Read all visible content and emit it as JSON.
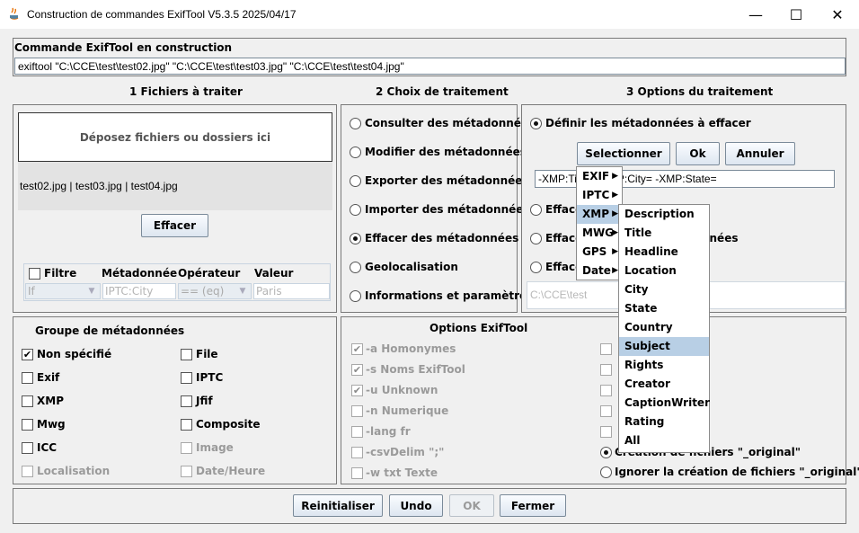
{
  "window": {
    "title": "Construction de commandes ExifTool V5.3.5 2025/04/17",
    "minimize_icon": "—",
    "maximize_icon": "☐",
    "close_icon": "✕"
  },
  "command": {
    "label": "Commande ExifTool en construction",
    "value": "exiftool  \"C:\\CCE\\test\\test02.jpg\" \"C:\\CCE\\test\\test03.jpg\" \"C:\\CCE\\test\\test04.jpg\""
  },
  "sections": {
    "files": "1  Fichiers à traiter",
    "choice": "2  Choix de traitement",
    "options": "3 Options du traitement"
  },
  "files": {
    "drop_label": "Déposez fichiers ou dossiers ici",
    "file_list": "test02.jpg | test03.jpg | test04.jpg",
    "clear_button": "Effacer",
    "filter": {
      "checkbox_label": "Filtre",
      "col_metadata": "Métadonnée",
      "col_operator": "Opérateur",
      "col_value": "Valeur",
      "if_value": "If",
      "metadata_placeholder": "IPTC:City",
      "operator_value": "== (eq)",
      "value_placeholder": "Paris"
    }
  },
  "treatments": [
    {
      "label": "Consulter des métadonnées",
      "selected": false
    },
    {
      "label": "Modifier des métadonnées",
      "selected": false
    },
    {
      "label": "Exporter des métadonnées",
      "selected": false
    },
    {
      "label": "Importer des métadonnées",
      "selected": false
    },
    {
      "label": "Effacer des métadonnées",
      "selected": true
    },
    {
      "label": "Geolocalisation",
      "selected": false
    },
    {
      "label": "Informations et paramètres",
      "selected": false
    }
  ],
  "options_panel": {
    "define_radio": "Définir les métadonnées à effacer",
    "select_button": "Selectionner",
    "ok_button": "Ok",
    "cancel_button": "Annuler",
    "tags_value": "-XMP:Title= -XMP:City= -XMP:State=",
    "radio2": "Effacer",
    "radio3": "Effacer toutes les métadonnées",
    "radio4": "Effacer",
    "path_value": "C:\\CCE\\test"
  },
  "groups": {
    "title": "Groupe de métadonnées",
    "left": [
      {
        "label": "Non spécifié",
        "checked": true,
        "disabled": false
      },
      {
        "label": "Exif",
        "checked": false,
        "disabled": false
      },
      {
        "label": "XMP",
        "checked": false,
        "disabled": false
      },
      {
        "label": "Mwg",
        "checked": false,
        "disabled": false
      },
      {
        "label": "ICC",
        "checked": false,
        "disabled": false
      },
      {
        "label": "Localisation",
        "checked": false,
        "disabled": true
      }
    ],
    "right": [
      {
        "label": "File",
        "checked": false,
        "disabled": false
      },
      {
        "label": "IPTC",
        "checked": false,
        "disabled": false
      },
      {
        "label": "Jfif",
        "checked": false,
        "disabled": false
      },
      {
        "label": "Composite",
        "checked": false,
        "disabled": false
      },
      {
        "label": "Image",
        "checked": false,
        "disabled": true
      },
      {
        "label": "Date/Heure",
        "checked": false,
        "disabled": true
      }
    ]
  },
  "exiftool_options": {
    "title": "Options ExifTool",
    "left": [
      {
        "label": "-a Homonymes",
        "checked": true
      },
      {
        "label": "-s Noms ExifTool",
        "checked": true
      },
      {
        "label": "-u Unknown",
        "checked": true
      },
      {
        "label": "-n Numerique",
        "checked": false
      },
      {
        "label": "-lang fr",
        "checked": false
      },
      {
        "label": "-csvDelim \";\"",
        "checked": false
      },
      {
        "label": "-w txt Texte",
        "checked": false
      }
    ],
    "radio_create": "Création de fichiers \"_original\"",
    "radio_ignore": "Ignorer la création de fichiers \"_original\""
  },
  "bottom_buttons": [
    "Reinitialiser",
    "Undo",
    "OK",
    "Fermer"
  ],
  "menu": {
    "groups": [
      "EXIF",
      "IPTC",
      "XMP",
      "MWG",
      "GPS",
      "Date"
    ],
    "xmp_items": [
      "Description",
      "Title",
      "Headline",
      "Location",
      "City",
      "State",
      "Country",
      "Subject",
      "Rights",
      "Creator",
      "CaptionWriter",
      "Rating",
      "All"
    ],
    "highlighted": "Subject",
    "submenu_arrow": "▶"
  }
}
